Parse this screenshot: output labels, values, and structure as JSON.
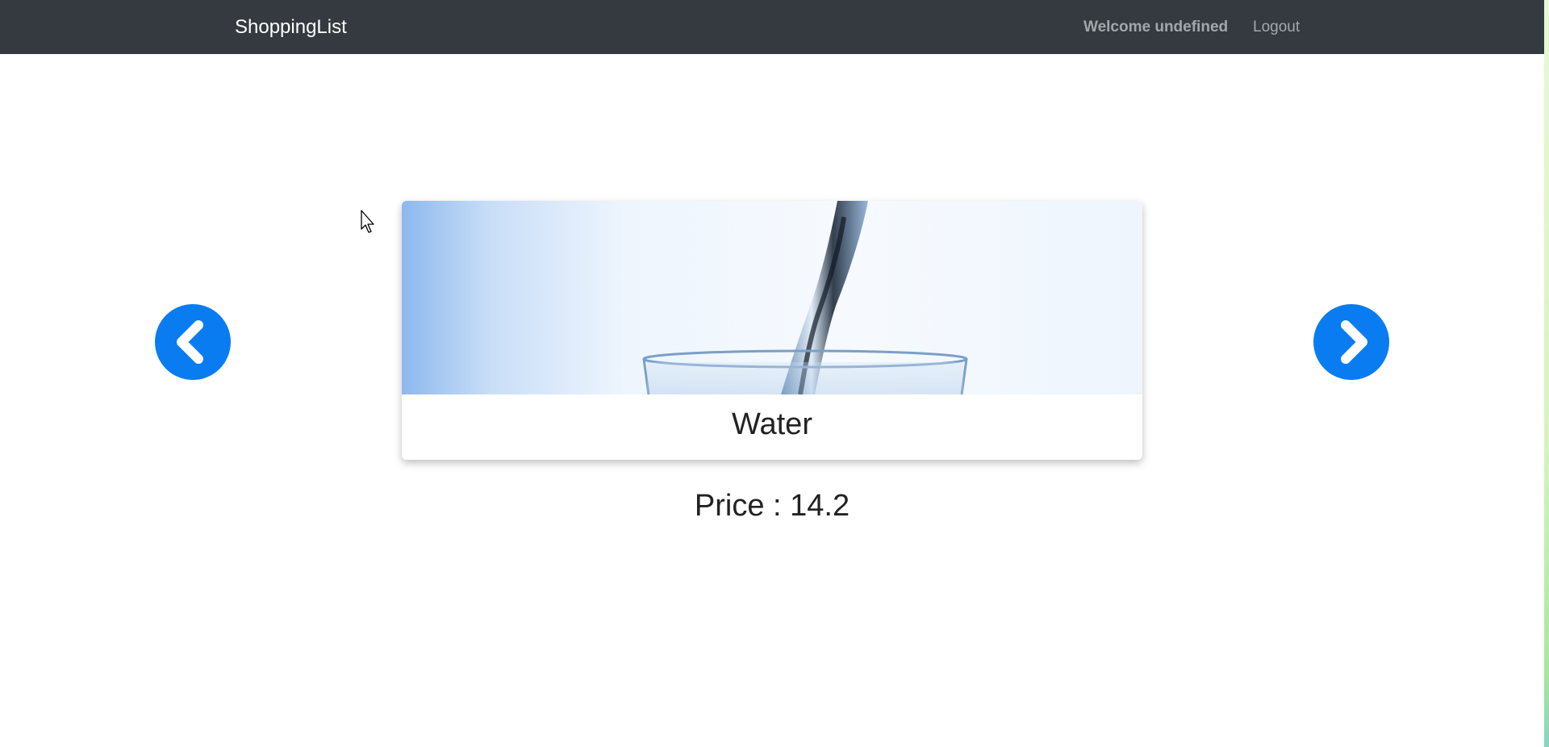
{
  "navbar": {
    "brand": "ShoppingList",
    "welcome": "Welcome undefined",
    "logout": "Logout",
    "background": "#343a40"
  },
  "carousel": {
    "prev_icon": "chevron-left-icon",
    "next_icon": "chevron-right-icon",
    "accent": "#0a7cf2",
    "item": {
      "name": "Water",
      "image_icon": "water-glass-image",
      "price_label": "Price : ",
      "price": "14.2"
    }
  }
}
